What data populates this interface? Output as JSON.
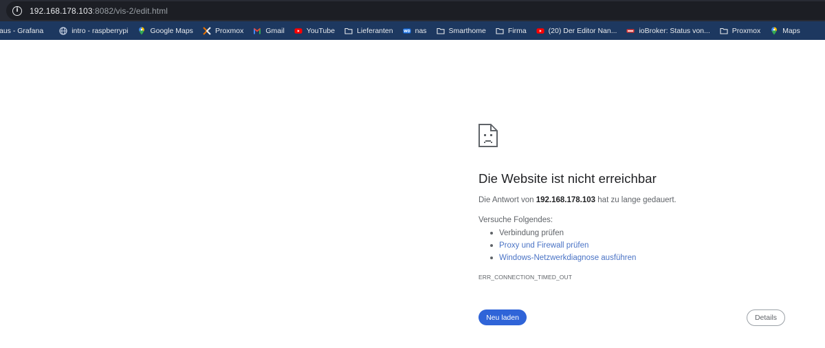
{
  "address_bar": {
    "icon": "info-icon",
    "url_host": "192.168.178.103",
    "url_rest": ":8082/vis-2/edit.html"
  },
  "bookmarks": [
    {
      "label": "aus - Grafana",
      "icon": "none"
    },
    {
      "label": "intro - raspberrypi",
      "icon": "globe-icon"
    },
    {
      "label": "Google Maps",
      "icon": "maps-pin-icon"
    },
    {
      "label": "Proxmox",
      "icon": "proxmox-icon"
    },
    {
      "label": "Gmail",
      "icon": "gmail-icon"
    },
    {
      "label": "YouTube",
      "icon": "youtube-icon"
    },
    {
      "label": "Lieferanten",
      "icon": "folder-icon"
    },
    {
      "label": "nas",
      "icon": "wd-icon"
    },
    {
      "label": "Smarthome",
      "icon": "folder-icon"
    },
    {
      "label": "Firma",
      "icon": "folder-icon"
    },
    {
      "label": "(20) Der Editor Nan...",
      "icon": "youtube-icon"
    },
    {
      "label": "ioBroker: Status von...",
      "icon": "iobroker-icon"
    },
    {
      "label": "Proxmox",
      "icon": "folder-icon"
    },
    {
      "label": "Maps",
      "icon": "maps-pin-icon"
    }
  ],
  "error": {
    "title": "Die Website ist nicht erreichbar",
    "desc_prefix": "Die Antwort von ",
    "desc_host": "192.168.178.103",
    "desc_suffix": " hat zu lange gedauert.",
    "try_heading": "Versuche Folgendes:",
    "suggestions": {
      "s1": "Verbindung prüfen",
      "s2": "Proxy und Firewall prüfen",
      "s3": "Windows-Netzwerkdiagnose ausführen"
    },
    "code": "ERR_CONNECTION_TIMED_OUT"
  },
  "buttons": {
    "reload": "Neu laden",
    "details": "Details"
  },
  "colors": {
    "bookmarks_bar": "#1d3860",
    "address_bar": "#282b34",
    "primary_button": "#2f64d8",
    "link": "#4a73c5"
  }
}
